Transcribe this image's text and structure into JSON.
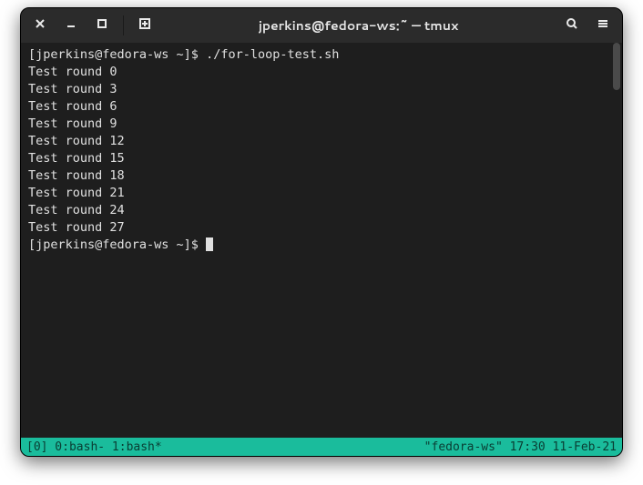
{
  "titlebar": {
    "title": "jperkins@fedora-ws:~ — tmux"
  },
  "terminal": {
    "prompt": "[jperkins@fedora-ws ~]$ ",
    "command": "./for-loop-test.sh",
    "output_lines": [
      "Test round 0",
      "Test round 3",
      "Test round 6",
      "Test round 9",
      "Test round 12",
      "Test round 15",
      "Test round 18",
      "Test round 21",
      "Test round 24",
      "Test round 27"
    ]
  },
  "statusbar": {
    "left": "[0] 0:bash- 1:bash*",
    "right": "\"fedora-ws\" 17:30 11-Feb-21"
  }
}
